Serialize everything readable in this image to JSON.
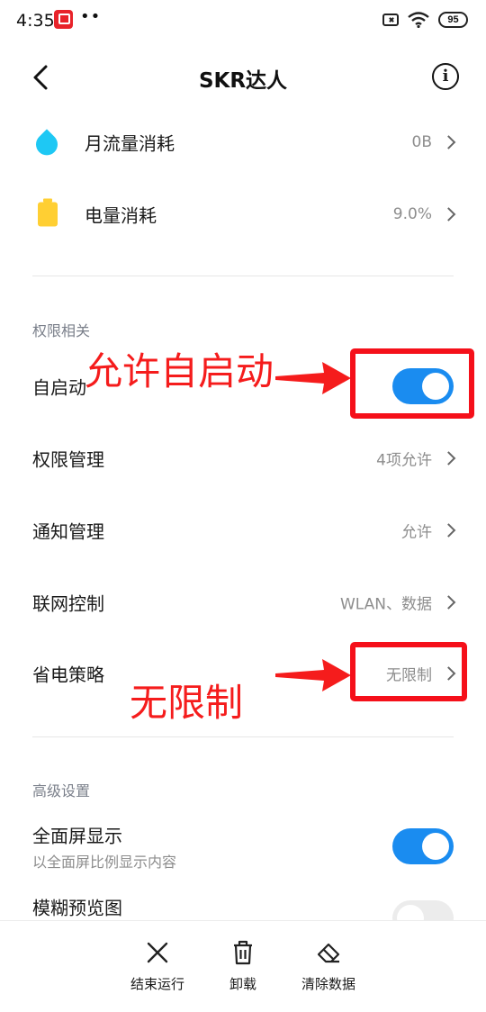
{
  "status_bar": {
    "time": "4:35",
    "dots": "••",
    "battery": "95"
  },
  "header": {
    "title": "SKR达人"
  },
  "usage": [
    {
      "label": "月流量消耗",
      "value": "0B",
      "icon": "water-drop-icon"
    },
    {
      "label": "电量消耗",
      "value": "9.0%",
      "icon": "battery-icon"
    }
  ],
  "permissions": {
    "section_title": "权限相关",
    "autostart_label": "自启动",
    "autostart_enabled": true,
    "items": [
      {
        "label": "权限管理",
        "value": "4项允许"
      },
      {
        "label": "通知管理",
        "value": "允许"
      },
      {
        "label": "联网控制",
        "value": "WLAN、数据"
      },
      {
        "label": "省电策略",
        "value": "无限制"
      }
    ]
  },
  "advanced": {
    "section_title": "高级设置",
    "fullscreen_label": "全面屏显示",
    "fullscreen_sub": "以全面屏比例显示内容",
    "fullscreen_enabled": true,
    "blur_label": "模糊预览图",
    "blur_enabled": false
  },
  "annotations": {
    "autostart_note": "允许自启动",
    "power_note": "无限制",
    "color": "#f51c1c"
  },
  "bottom_bar": [
    {
      "label": "结束运行",
      "icon": "close-icon"
    },
    {
      "label": "卸载",
      "icon": "trash-icon"
    },
    {
      "label": "清除数据",
      "icon": "eraser-icon"
    }
  ],
  "colors": {
    "accent": "#1a8cf0",
    "drop": "#1ec8f4",
    "battery": "#ffcf33"
  }
}
